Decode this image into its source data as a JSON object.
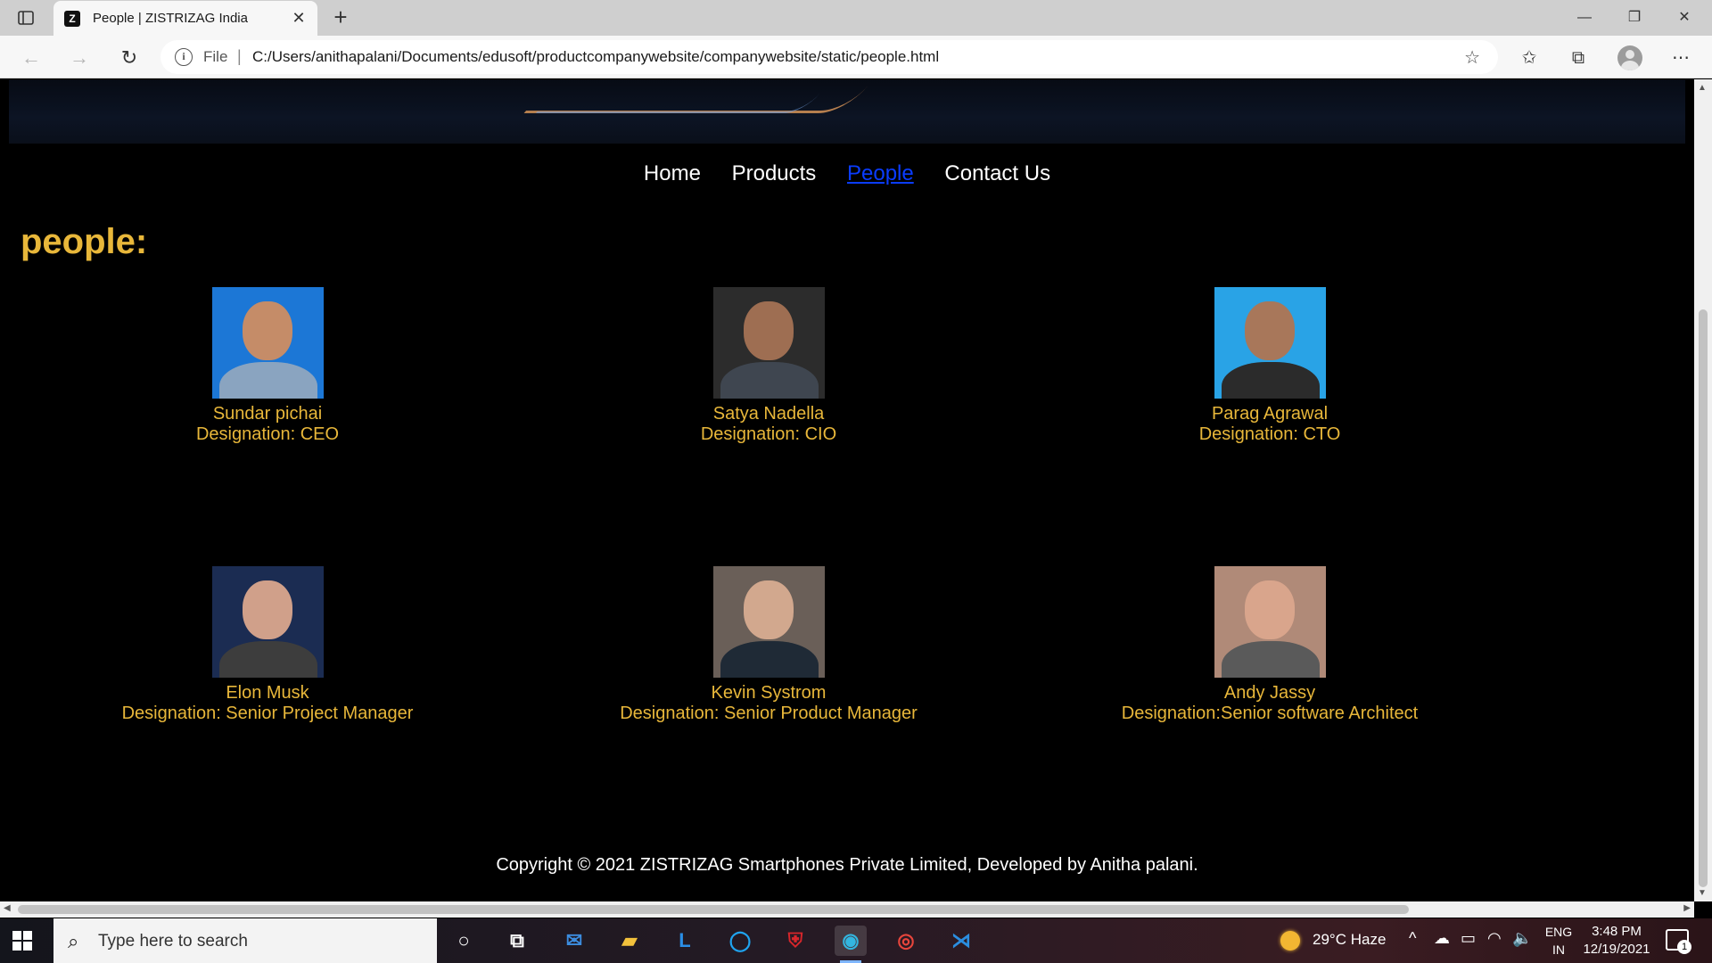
{
  "browser": {
    "tab_title": "People | ZISTRIZAG India",
    "tab_favicon": "Z",
    "url_scheme_label": "File",
    "url": "C:/Users/anithapalani/Documents/edusoft/productcompanywebsite/companywebsite/static/people.html",
    "icons": [
      "tab-actions-icon",
      "close-icon",
      "plus-icon",
      "minimize-icon",
      "restore-icon",
      "back-icon",
      "forward-icon",
      "refresh-icon",
      "info-icon",
      "add-favorite-icon",
      "favorites-icon",
      "collections-icon",
      "profile-icon",
      "more-icon"
    ]
  },
  "page": {
    "nav": [
      {
        "label": "Home"
      },
      {
        "label": "Products"
      },
      {
        "label": "People",
        "active": true
      },
      {
        "label": "Contact Us"
      }
    ],
    "heading": "people:",
    "people": [
      {
        "name": "Sundar pichai",
        "designation": "Designation: CEO",
        "bg": "#1c77d6",
        "skin": "#c58c68",
        "shirt": "#8aa4c0"
      },
      {
        "name": "Satya Nadella",
        "designation": "Designation: CIO",
        "bg": "#2c2c2c",
        "skin": "#9e6e52",
        "shirt": "#3f4650"
      },
      {
        "name": "Parag Agrawal",
        "designation": "Designation: CTO",
        "bg": "#29a3e6",
        "skin": "#a8775a",
        "shirt": "#2b2b2b"
      },
      {
        "name": "Elon Musk",
        "designation": "Designation: Senior Project Manager",
        "bg": "#1b2c52",
        "skin": "#d0a08a",
        "shirt": "#3d3d3d"
      },
      {
        "name": "Kevin Systrom",
        "designation": "Designation: Senior Product Manager",
        "bg": "#6a5f58",
        "skin": "#d2a88e",
        "shirt": "#1f2a36"
      },
      {
        "name": "Andy Jassy",
        "designation": "Designation:Senior software Architect",
        "bg": "#b08a78",
        "skin": "#d9a58c",
        "shirt": "#5a5a5a"
      }
    ],
    "footer": "Copyright © 2021 ZISTRIZAG Smartphones Private Limited, Developed by Anitha palani."
  },
  "taskbar": {
    "search_placeholder": "Type here to search",
    "weather": "29°C  Haze",
    "lang_line1": "ENG",
    "lang_line2": "IN",
    "time": "3:48 PM",
    "date": "12/19/2021",
    "notification_count": "1",
    "pinned": [
      {
        "name": "cortana-icon",
        "glyph": "○",
        "color": "#ffffff"
      },
      {
        "name": "task-view-icon",
        "glyph": "⧉",
        "color": "#ffffff"
      },
      {
        "name": "mail-icon",
        "glyph": "✉",
        "color": "#3c8de0"
      },
      {
        "name": "file-explorer-icon",
        "glyph": "▰",
        "color": "#f2c13c"
      },
      {
        "name": "l-app-icon",
        "glyph": "L",
        "color": "#2a8ee6"
      },
      {
        "name": "circle-app-icon",
        "glyph": "◯",
        "color": "#1fa4f0"
      },
      {
        "name": "shield-app-icon",
        "glyph": "⛨",
        "color": "#d8262b"
      },
      {
        "name": "edge-icon",
        "glyph": "◉",
        "color": "#33b6e0",
        "active": true
      },
      {
        "name": "chrome-icon",
        "glyph": "◎",
        "color": "#e8453c"
      },
      {
        "name": "vscode-icon",
        "glyph": "⋊",
        "color": "#2b8ee0"
      }
    ]
  }
}
